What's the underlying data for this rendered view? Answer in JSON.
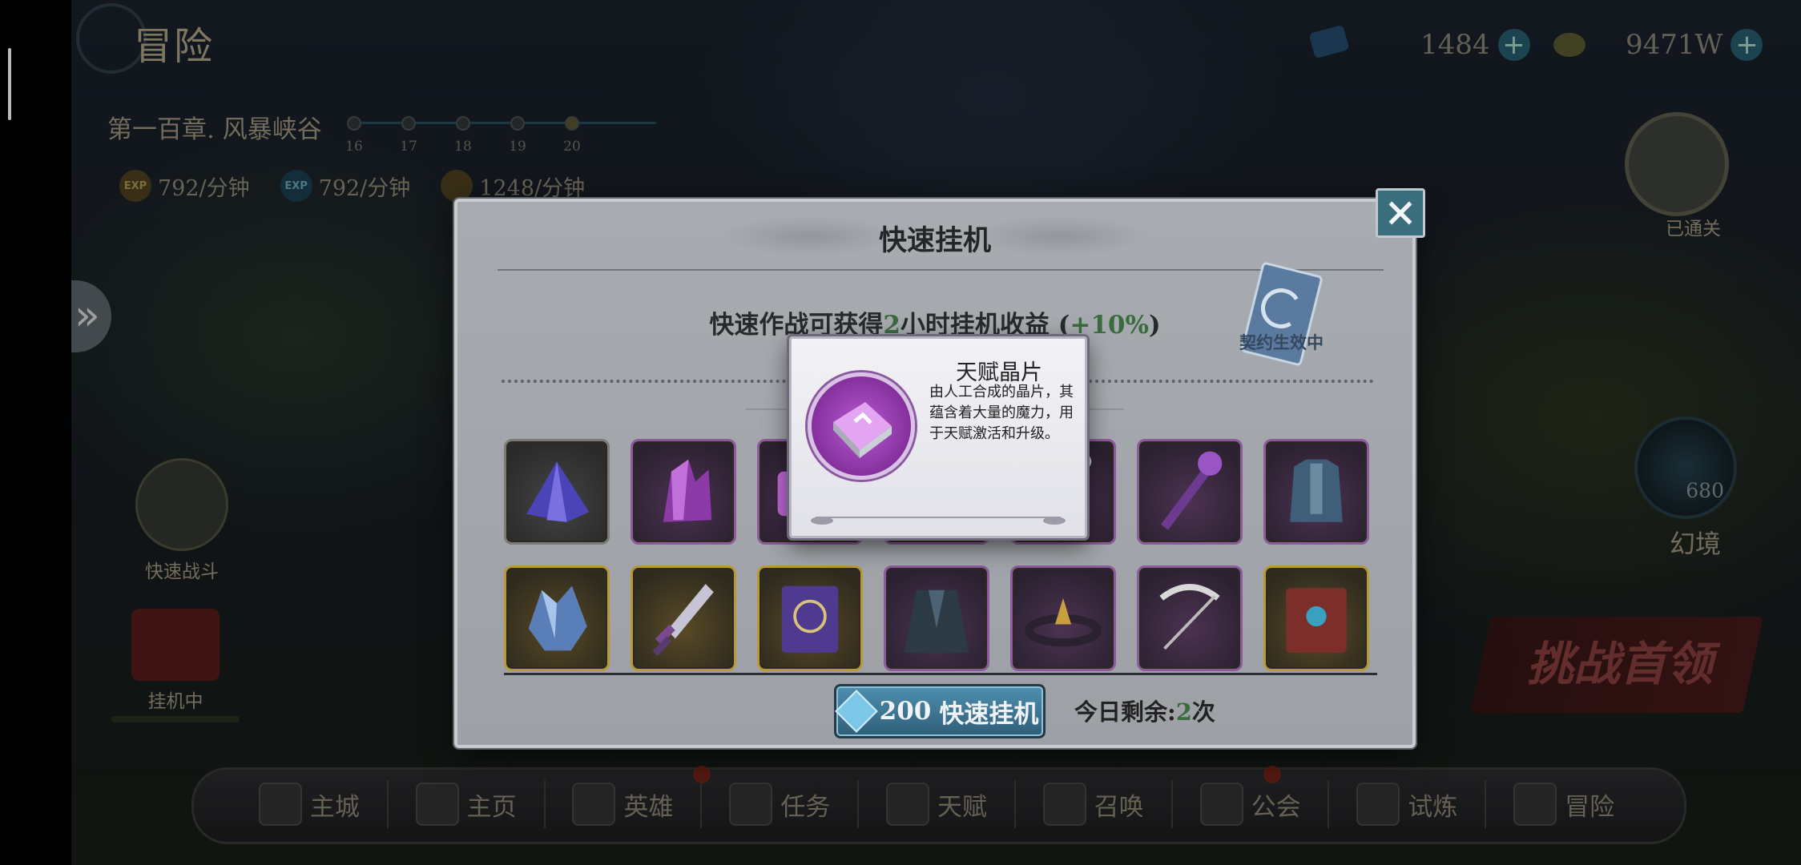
{
  "hud": {
    "title": "冒险",
    "resource1": "1484",
    "resource2": "9471W",
    "chapter": "第一百章. 风暴峡谷",
    "stages": [
      "16",
      "17",
      "18",
      "19",
      "20"
    ],
    "rates": [
      {
        "icon": "EXP",
        "value": "792/分钟"
      },
      {
        "icon": "EXP",
        "value": "792/分钟"
      },
      {
        "icon": "",
        "value": "1248/分钟"
      }
    ],
    "quick_battle_label": "快速战斗",
    "chest_label": "挂机中",
    "cleared_label": "已通关",
    "portal_count": "680",
    "portal_label": "幻境",
    "challenge_label": "挑战首领"
  },
  "nav": [
    {
      "label": "主城"
    },
    {
      "label": "主页"
    },
    {
      "label": "英雄"
    },
    {
      "label": "任务"
    },
    {
      "label": "天赋"
    },
    {
      "label": "召唤"
    },
    {
      "label": "公会"
    },
    {
      "label": "试炼"
    },
    {
      "label": "冒险"
    }
  ],
  "modal": {
    "title": "快速挂机",
    "subtitle_pre": "快速作战可获得",
    "subtitle_hours": "2",
    "subtitle_mid": "小时挂机收益 (",
    "subtitle_bonus": "+10%",
    "subtitle_post": ")",
    "card_label": "契约生效中",
    "button_cost": "200",
    "button_label": "快速挂机",
    "remaining_label": "今日剩余:",
    "remaining_count": "2",
    "remaining_unit": "次",
    "items": [
      {
        "name": "purple-crystal-pile",
        "rarity": "gray"
      },
      {
        "name": "purple-crystal-cluster",
        "rarity": "purple"
      },
      {
        "name": "talent-chip",
        "rarity": "purple"
      },
      {
        "name": "hidden-item",
        "rarity": "purple"
      },
      {
        "name": "staff",
        "rarity": "purple"
      },
      {
        "name": "purple-staff",
        "rarity": "purple"
      },
      {
        "name": "armor",
        "rarity": "purple"
      },
      {
        "name": "crystal-helmet",
        "rarity": "gold"
      },
      {
        "name": "dagger",
        "rarity": "gold"
      },
      {
        "name": "spell-book",
        "rarity": "gold"
      },
      {
        "name": "cloak",
        "rarity": "purple"
      },
      {
        "name": "crown-ring",
        "rarity": "purple"
      },
      {
        "name": "bow",
        "rarity": "purple"
      },
      {
        "name": "red-tome",
        "rarity": "gold"
      }
    ]
  },
  "tooltip": {
    "title": "天赋晶片",
    "description": "由人工合成的晶片，其蕴含着大量的魔力，用于天赋激活和升级。"
  },
  "colors": {
    "highlight_green": "#3a6b3e",
    "button_blue": "#2f5e78",
    "gold_border": "#b99838",
    "purple_border": "#8d5a9d"
  }
}
